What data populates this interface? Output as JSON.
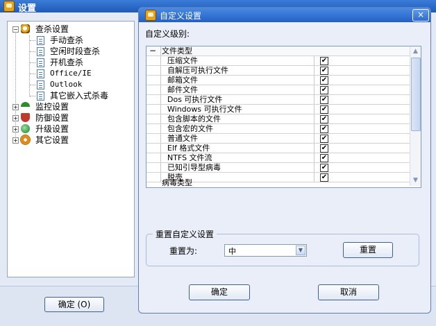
{
  "main": {
    "title": "设置",
    "ok_label": "确定 (O)"
  },
  "tree": {
    "nodes": {
      "scan": "查杀设置",
      "manual": "手动查杀",
      "idle": "空闲时段查杀",
      "boot": "开机查杀",
      "office": "Office/IE",
      "outlook": "Outlook",
      "embedded": "其它嵌入式杀毒",
      "monitor": "监控设置",
      "defense": "防御设置",
      "upgrade": "升级设置",
      "other": "其它设置"
    },
    "selected": "embedded"
  },
  "dialog": {
    "title": "自定义设置",
    "close": "×",
    "level_label": "自定义级别:",
    "group_header": "文件类型",
    "group_toggle": "−",
    "rows": [
      {
        "label": "压缩文件",
        "checked": true
      },
      {
        "label": "自解压可执行文件",
        "checked": true
      },
      {
        "label": "邮箱文件",
        "checked": true
      },
      {
        "label": "邮件文件",
        "checked": true
      },
      {
        "label": "Dos 可执行文件",
        "checked": true
      },
      {
        "label": "Windows 可执行文件",
        "checked": true
      },
      {
        "label": "包含脚本的文件",
        "checked": true
      },
      {
        "label": "包含宏的文件",
        "checked": true
      },
      {
        "label": "普通文件",
        "checked": true
      },
      {
        "label": "Elf 格式文件",
        "checked": true
      },
      {
        "label": "NTFS 文件流",
        "checked": true
      },
      {
        "label": "已知引导型病毒",
        "checked": true
      },
      {
        "label": "脱壳",
        "checked": true
      }
    ],
    "next_group_partial": "病毒类型",
    "check_mark": "✔",
    "reset": {
      "group_title": "重置自定义设置",
      "to_label": "重置为:",
      "selected_value": "中",
      "button": "重置"
    },
    "ok": "确定",
    "cancel": "取消"
  },
  "icons": {
    "app": "app-shield-icon",
    "scan": "magnifier-icon",
    "monitor": "umbrella-icon",
    "defense": "shield-icon",
    "upgrade": "globe-icon",
    "other": "gear-icon",
    "file": "document-icon"
  },
  "colors": {
    "title_bar": "#2360c4",
    "tree_icon_scan": "#e8a21a",
    "tree_icon_monitor": "#2d8b2d",
    "tree_icon_defense": "#c0392b",
    "tree_icon_upgrade": "#3a9a4a",
    "tree_icon_other": "#e08a1a"
  }
}
